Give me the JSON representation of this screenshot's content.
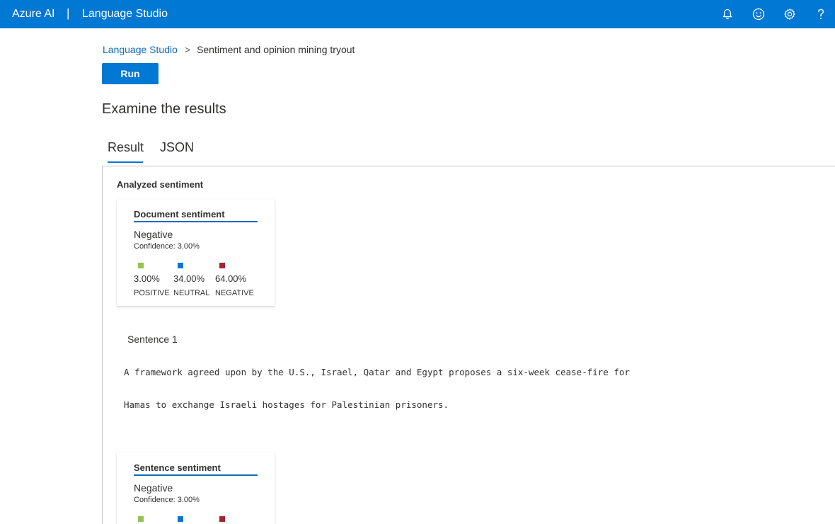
{
  "topbar": {
    "brand": "Azure AI",
    "separator": "|",
    "product": "Language Studio",
    "icons": [
      "bell-icon",
      "smiley-icon",
      "gear-icon",
      "help-icon"
    ]
  },
  "breadcrumb": {
    "root": "Language Studio",
    "separator": ">",
    "current": "Sentiment and opinion mining tryout"
  },
  "run_label": "Run",
  "heading": "Examine the results",
  "tabs": [
    {
      "label": "Result",
      "active": true
    },
    {
      "label": "JSON",
      "active": false
    }
  ],
  "panel": {
    "title": "Analyzed sentiment",
    "document": {
      "title": "Document sentiment",
      "sentiment": "Negative",
      "confidence": "Confidence: 3.00%",
      "scores": [
        {
          "pct": "3.00%",
          "label": "POSITIVE",
          "color": "#92c353"
        },
        {
          "pct": "34.00%",
          "label": "NEUTRAL",
          "color": "#0078d4"
        },
        {
          "pct": "64.00%",
          "label": "NEGATIVE",
          "color": "#a4262c"
        }
      ]
    },
    "sentence": {
      "title": "Sentence 1",
      "lines": [
        "A framework agreed upon by the U.S., Israel, Qatar and Egypt proposes a six-week cease-fire for",
        "Hamas to exchange Israeli hostages for Palestinian prisoners."
      ],
      "card": {
        "title": "Sentence sentiment",
        "sentiment": "Negative",
        "confidence": "Confidence: 3.00%",
        "scores": [
          {
            "color": "#92c353"
          },
          {
            "color": "#0078d4"
          },
          {
            "color": "#a4262c"
          }
        ]
      }
    }
  }
}
